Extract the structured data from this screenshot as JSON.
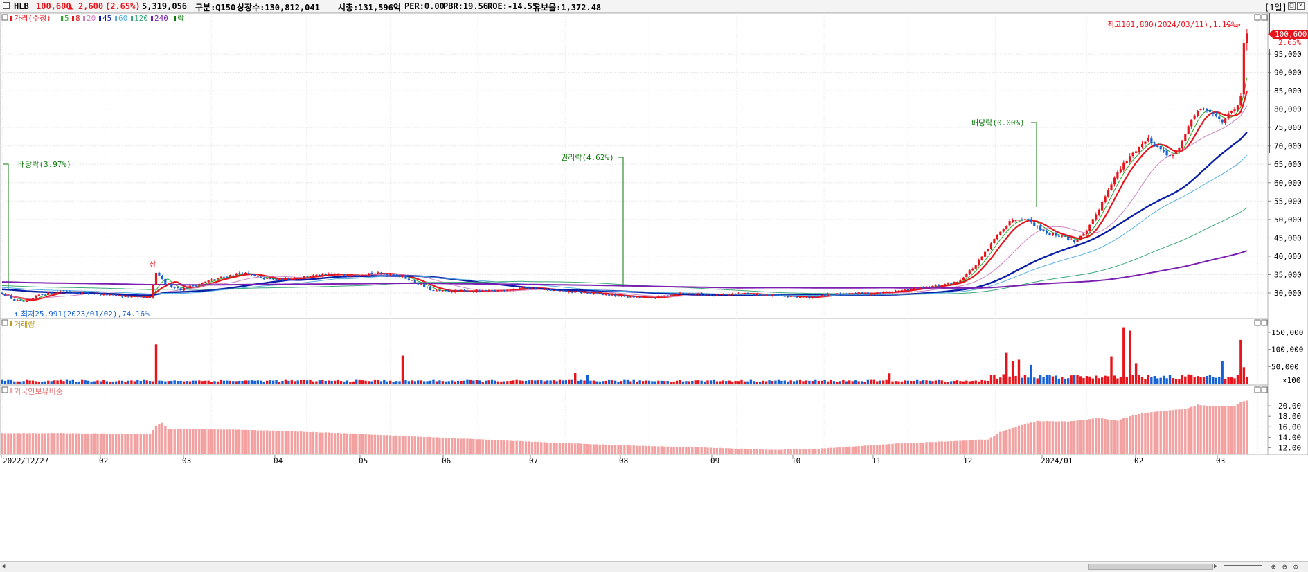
{
  "header": {
    "ticker": "HLB",
    "price": "100,600",
    "change_arrow": "▲",
    "change": "2,600",
    "change_pct": "(2.65%)",
    "volume": "5,319,056",
    "market": "구분:Q150",
    "shares": "상장수:130,812,041",
    "mcap": "시총:131,596억",
    "per": "PER:0.00",
    "pbr": "PBR:19.56",
    "roe": "ROE:-14.55",
    "reserve": "유보율:1,372.48",
    "period": "[1일]"
  },
  "legend": {
    "price": "가격(수정)",
    "ma5": "5",
    "ma8": "8",
    "ma20": "20",
    "ma45": "45",
    "ma60": "60",
    "ma120": "120",
    "ma240": "240",
    "rak": "락"
  },
  "colors": {
    "up": "#e8141b",
    "down": "#1560d4",
    "ma5": "#22aa22",
    "ma8": "#e8141b",
    "ma20": "#d080c0",
    "ma45": "#0a1fa8",
    "ma60": "#55b0e0",
    "ma120": "#3aa878",
    "ma240": "#7a1fb0",
    "foreign": "#f2a0a0",
    "annotation": "#0b7a0b"
  },
  "annotations": {
    "div1": "배당락(3.97%)",
    "rights": "권리락(4.62%)",
    "div2": "배당락(0.00%)",
    "high": "최고101,800(2024/03/11),1.19%→",
    "low": "최저25,991(2023/01/02),74.16%",
    "limit_up": "상",
    "last_price": "100,600",
    "last_pct": "2.65%"
  },
  "panels": {
    "volume_title": "거래량",
    "foreign_title": "외국인보유비중"
  },
  "chart_data": {
    "type": "candlestick",
    "x_labels": [
      "2022/12/27",
      "02",
      "03",
      "04",
      "05",
      "06",
      "07",
      "08",
      "09",
      "10",
      "11",
      "12",
      "2024/01",
      "02",
      "03"
    ],
    "price_axis": {
      "ticks": [
        30000,
        35000,
        40000,
        45000,
        50000,
        55000,
        60000,
        65000,
        70000,
        75000,
        80000,
        85000,
        90000,
        95000
      ],
      "tick_labels": [
        "30,000",
        "35,000",
        "40,000",
        "45,000",
        "50,000",
        "55,000",
        "60,000",
        "65,000",
        "70,000",
        "75,000",
        "80,000",
        "85,000",
        "90,000",
        "95,000"
      ],
      "range": [
        25000,
        103000
      ]
    },
    "price_anchors": [
      [
        0,
        30000
      ],
      [
        4,
        28000
      ],
      [
        8,
        27500
      ],
      [
        12,
        29500
      ],
      [
        20,
        30500
      ],
      [
        30,
        29800
      ],
      [
        40,
        29000
      ],
      [
        48,
        28600
      ],
      [
        50,
        35500
      ],
      [
        53,
        32500
      ],
      [
        58,
        31000
      ],
      [
        62,
        32000
      ],
      [
        68,
        33500
      ],
      [
        74,
        34800
      ],
      [
        78,
        35500
      ],
      [
        84,
        34000
      ],
      [
        90,
        33500
      ],
      [
        98,
        34500
      ],
      [
        108,
        35000
      ],
      [
        112,
        34800
      ],
      [
        120,
        35400
      ],
      [
        128,
        35000
      ],
      [
        134,
        33000
      ],
      [
        140,
        30500
      ],
      [
        150,
        30500
      ],
      [
        160,
        30500
      ],
      [
        170,
        31500
      ],
      [
        180,
        30500
      ],
      [
        190,
        30000
      ],
      [
        200,
        29200
      ],
      [
        210,
        28500
      ],
      [
        220,
        30000
      ],
      [
        230,
        29500
      ],
      [
        240,
        29800
      ],
      [
        250,
        29200
      ],
      [
        256,
        29000
      ],
      [
        262,
        28800
      ],
      [
        268,
        29500
      ],
      [
        276,
        30000
      ],
      [
        282,
        29800
      ],
      [
        290,
        30500
      ],
      [
        300,
        31500
      ],
      [
        310,
        33000
      ],
      [
        316,
        37500
      ],
      [
        320,
        42000
      ],
      [
        324,
        47000
      ],
      [
        328,
        50000
      ],
      [
        332,
        50500
      ],
      [
        336,
        48000
      ],
      [
        340,
        46000
      ],
      [
        344,
        45500
      ],
      [
        348,
        44000
      ],
      [
        352,
        46500
      ],
      [
        356,
        53000
      ],
      [
        360,
        60000
      ],
      [
        364,
        65000
      ],
      [
        368,
        69000
      ],
      [
        372,
        72000
      ],
      [
        376,
        69000
      ],
      [
        380,
        67000
      ],
      [
        384,
        73000
      ],
      [
        388,
        80000
      ],
      [
        392,
        79000
      ],
      [
        396,
        77000
      ],
      [
        400,
        79500
      ],
      [
        402,
        83000
      ],
      [
        403,
        98000
      ],
      [
        404,
        100600
      ]
    ],
    "ma_series": [
      {
        "name": "5",
        "anchors": []
      },
      {
        "name": "8",
        "anchors": []
      },
      {
        "name": "20",
        "anchors": []
      },
      {
        "name": "45",
        "anchors": []
      },
      {
        "name": "60",
        "anchors": []
      },
      {
        "name": "120",
        "anchors": []
      },
      {
        "name": "240",
        "anchors": []
      }
    ],
    "volume_axis": {
      "ticks": [
        50000,
        100000,
        150000
      ],
      "tick_labels": [
        "50,000",
        "100,000",
        "150,000",
        "×100"
      ],
      "range": [
        0,
        175000
      ]
    },
    "volume_spikes": [
      [
        50,
        115000
      ],
      [
        130,
        82000
      ],
      [
        186,
        32000
      ],
      [
        190,
        25000
      ],
      [
        288,
        30000
      ],
      [
        326,
        90000
      ],
      [
        328,
        65000
      ],
      [
        330,
        70000
      ],
      [
        334,
        55000
      ],
      [
        360,
        80000
      ],
      [
        364,
        165000
      ],
      [
        366,
        155000
      ],
      [
        368,
        60000
      ],
      [
        396,
        65000
      ],
      [
        402,
        128000
      ],
      [
        403,
        48000
      ]
    ],
    "foreign_axis": {
      "ticks": [
        12,
        14,
        16,
        18,
        20
      ],
      "tick_labels": [
        "12.00",
        "14.00",
        "16.00",
        "18.00",
        "20.00"
      ],
      "range": [
        11,
        22
      ]
    },
    "foreign_anchors": [
      [
        0,
        14.8
      ],
      [
        20,
        14.8
      ],
      [
        48,
        14.6
      ],
      [
        50,
        16.2
      ],
      [
        52,
        16.7
      ],
      [
        54,
        15.6
      ],
      [
        80,
        15.4
      ],
      [
        110,
        14.8
      ],
      [
        140,
        14.0
      ],
      [
        170,
        13.2
      ],
      [
        200,
        12.5
      ],
      [
        230,
        12.0
      ],
      [
        250,
        11.6
      ],
      [
        262,
        11.7
      ],
      [
        270,
        12.0
      ],
      [
        290,
        12.8
      ],
      [
        310,
        13.3
      ],
      [
        320,
        13.6
      ],
      [
        324,
        15.0
      ],
      [
        330,
        16.2
      ],
      [
        336,
        17.1
      ],
      [
        346,
        17.0
      ],
      [
        352,
        17.4
      ],
      [
        356,
        17.7
      ],
      [
        358,
        17.5
      ],
      [
        362,
        17.2
      ],
      [
        366,
        18.0
      ],
      [
        370,
        18.6
      ],
      [
        376,
        19.0
      ],
      [
        380,
        19.2
      ],
      [
        384,
        19.4
      ],
      [
        388,
        20.2
      ],
      [
        392,
        19.9
      ],
      [
        400,
        20.0
      ],
      [
        402,
        20.8
      ],
      [
        404,
        21.0
      ]
    ]
  }
}
